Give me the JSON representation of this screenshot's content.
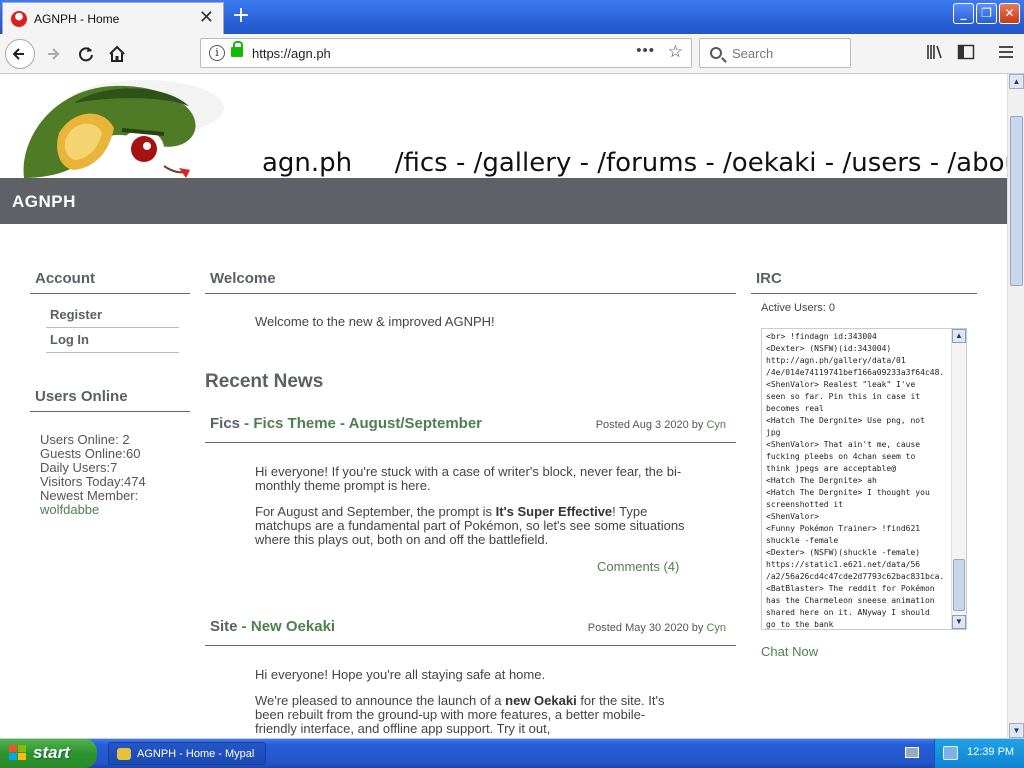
{
  "browser": {
    "tab_title": "AGNPH - Home",
    "tab_close": "✕",
    "new_tab": "+",
    "url": "https://agn.ph",
    "search_placeholder": "Search",
    "page_actions": "•••",
    "bookmark_star": "☆",
    "window_buttons": [
      "_",
      "❐",
      "✕"
    ]
  },
  "site": {
    "nav": [
      "agn.ph",
      "/fics",
      "/gallery",
      "/forums",
      "/oekaki",
      "/users",
      "/about"
    ],
    "banner_title": "AGNPH"
  },
  "account": {
    "heading": "Account",
    "links": [
      "Register",
      "Log In"
    ]
  },
  "users_online": {
    "heading": "Users Online",
    "stats": [
      "Users Online: 2",
      "Guests Online:60",
      "Daily Users:7",
      "Visitors Today:474",
      "Newest Member:"
    ],
    "newest_member": "wolfdabbe"
  },
  "welcome": {
    "heading": "Welcome",
    "text": "Welcome to the new & improved AGNPH!"
  },
  "recent_news": {
    "heading": "Recent News",
    "posts": [
      {
        "category": "Fics",
        "sep": " - ",
        "title_parts": [
          "Fics Theme",
          "August/September"
        ],
        "posted": "Posted Aug 3 2020 by",
        "author": "Cyn",
        "para1": "Hi everyone! If you're stuck with a case of writer's block, never fear, the bi-monthly theme prompt is here.",
        "para2_pre": "For August and September, the prompt is ",
        "para2_bold": "It's Super Effective",
        "para2_post": "! Type matchups are a fundamental part of Pokémon, so let's see some situations where this plays out, both on and off the battlefield.",
        "comments": "Comments (4)"
      },
      {
        "category": "Site",
        "sep": " - ",
        "title": "New Oekaki",
        "posted": "Posted May 30 2020 by",
        "author": "Cyn",
        "para1": "Hi everyone! Hope you're all staying safe at home.",
        "para2_pre": "We're pleased to announce the launch of a ",
        "para2_bold": "new Oekaki",
        "para2_post": " for the site. It's been rebuilt from the ground-up with more features, a better mobile-friendly interface, and offline app support. Try it out,"
      }
    ]
  },
  "irc": {
    "heading": "IRC",
    "active_users": "Active Users: 0",
    "lines": [
      "<br> !findagn id:343004",
      "<Dexter> (NSFW)(id:343004)",
      "http://agn.ph/gallery/data/01",
      "/4e/014e74119741bef166a09233a3f64c48.",
      "<ShenValor> Realest \"leak\" I've",
      "seen so far. Pin this in case it",
      "becomes real",
      "<Hatch The Dergnite> Use png, not",
      "jpg",
      "<ShenValor> That ain't me, cause",
      "fucking pleebs on 4chan seem to",
      "think jpegs are acceptable@",
      "<Hatch The Dergnite> ah",
      "<Hatch The Dergnite> I thought you",
      "screenshotted it",
      "<ShenValor>",
      "<Funny Pokémon Trainer> !find621",
      "shuckle -female",
      "<Dexter> (NSFW)(shuckle -female)",
      "https://static1.e621.net/data/56",
      "/a2/56a26cd4c47cde2d7793c62bac831bca.",
      "<BatBlaster> The reddit for Pokémon",
      "has the Charmeleon sneese animation",
      "shared here on it. ANyway I should",
      "go to the bank"
    ],
    "chat_now": "Chat Now"
  },
  "taskbar": {
    "start": "start",
    "window_item": "AGNPH - Home - Mypal",
    "clock": "12:39 PM"
  }
}
